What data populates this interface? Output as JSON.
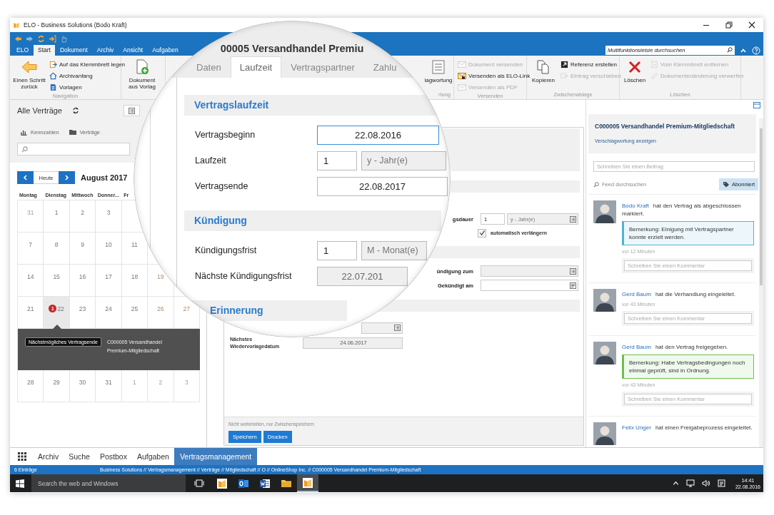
{
  "window": {
    "title": "ELO - Business Solutions (Bodo Kraft)"
  },
  "ribbon": {
    "tabs": [
      {
        "label": "ELO",
        "selected": false
      },
      {
        "label": "Start",
        "selected": true
      },
      {
        "label": "Dokument",
        "selected": false
      },
      {
        "label": "Archiv",
        "selected": false
      },
      {
        "label": "Ansicht",
        "selected": false
      },
      {
        "label": "Aufgaben",
        "selected": false
      }
    ],
    "search": {
      "placeholder": "Multifunktionsleiste durchsuchen"
    },
    "groups": [
      {
        "label": "Navigation",
        "items": [
          {
            "kind": "large",
            "label": "Einen Schritt zurück",
            "disabled": false
          },
          {
            "kind": "small",
            "label": "Auf das Klemmbrett legen",
            "disabled": false
          },
          {
            "kind": "small",
            "label": "Archivanfang",
            "disabled": false
          },
          {
            "kind": "small",
            "label": "Vorlagen",
            "disabled": false
          }
        ]
      },
      {
        "items": [
          {
            "kind": "large",
            "label": "Dokument aus Vorlag",
            "disabled": false
          }
        ]
      },
      {
        "label": "rtung",
        "items": [
          {
            "kind": "large",
            "label": "lagwortung",
            "disabled": false
          }
        ]
      },
      {
        "label": "Versenden",
        "items": [
          {
            "kind": "small",
            "label": "Dokument versenden",
            "disabled": true
          },
          {
            "kind": "small",
            "label": "Versenden als ELO-Link",
            "disabled": false
          },
          {
            "kind": "small",
            "label": "Versenden als PDF",
            "disabled": true
          }
        ]
      },
      {
        "label": "Zwischenablage",
        "items": [
          {
            "kind": "large",
            "label": "Kopieren",
            "disabled": false
          },
          {
            "kind": "small",
            "label": "Referenz erstellen",
            "disabled": false
          },
          {
            "kind": "small",
            "label": "Eintrag verschieben",
            "disabled": true
          }
        ]
      },
      {
        "label": "Löschen",
        "items": [
          {
            "kind": "large",
            "label": "Löschen",
            "disabled": false
          },
          {
            "kind": "small",
            "label": "Vom Klemmbrett entfernen",
            "disabled": true
          },
          {
            "kind": "small",
            "label": "Dokumentenänderung verwerfen",
            "disabled": true
          }
        ]
      }
    ]
  },
  "left_panel": {
    "title": "Alle Verträge",
    "toolbar": [
      "Kennzahlen",
      "Verträge"
    ]
  },
  "calendar": {
    "today_button": "Heute",
    "month": "August 2017",
    "weekdays": [
      "Montag",
      "Dienstag",
      "Mittwoch",
      "Donner...",
      "Fr"
    ],
    "weeks": [
      [
        {
          "day": "31",
          "muted": true,
          "selected": false
        },
        {
          "day": "1",
          "muted": false,
          "selected": false
        },
        {
          "day": "2",
          "muted": false,
          "selected": false
        },
        {
          "day": "3",
          "muted": false,
          "selected": false
        }
      ],
      [
        {
          "day": "7",
          "muted": false,
          "selected": false
        },
        {
          "day": "8",
          "muted": false,
          "selected": false
        },
        {
          "day": "9",
          "muted": false,
          "selected": false
        },
        {
          "day": "10",
          "muted": false,
          "selected": false
        },
        {
          "day": "11",
          "muted": false,
          "selected": false
        }
      ],
      [
        {
          "day": "14",
          "muted": false,
          "selected": false
        },
        {
          "day": "15",
          "muted": false,
          "selected": false
        },
        {
          "day": "16",
          "muted": false,
          "selected": false
        },
        {
          "day": "17",
          "muted": false,
          "selected": false
        },
        {
          "day": "18",
          "muted": false,
          "selected": false
        },
        {
          "day": "19",
          "muted": false,
          "selected": false
        }
      ],
      [
        {
          "day": "21",
          "muted": false,
          "selected": false
        },
        {
          "day": "22",
          "muted": false,
          "selected": true,
          "badge": "1"
        },
        {
          "day": "23",
          "muted": false,
          "selected": false
        },
        {
          "day": "24",
          "muted": false,
          "selected": false
        },
        {
          "day": "25",
          "muted": false,
          "selected": false
        },
        {
          "day": "26",
          "muted": false,
          "selected": false
        },
        {
          "day": "27",
          "muted": false,
          "selected": false
        }
      ],
      [
        {
          "day": "28",
          "muted": false,
          "selected": false
        },
        {
          "day": "29",
          "muted": false,
          "selected": false
        },
        {
          "day": "30",
          "muted": false,
          "selected": false
        },
        {
          "day": "31",
          "muted": false,
          "selected": false
        },
        {
          "day": "1",
          "muted": true,
          "selected": false
        },
        {
          "day": "2",
          "muted": true,
          "selected": false
        },
        {
          "day": "3",
          "muted": true,
          "selected": false
        }
      ]
    ],
    "popup": {
      "tag": "Nächstmögliches Vertragsende",
      "text": "C000005 Versandhandel Premium-Mitgliedschaft"
    }
  },
  "lens": {
    "title": "00005 Versandhandel Premiu",
    "tabs": [
      {
        "label": "Daten",
        "selected": false
      },
      {
        "label": "Laufzeit",
        "selected": true
      },
      {
        "label": "Vertragspartner",
        "selected": false
      },
      {
        "label": "Zahlu",
        "selected": false
      }
    ],
    "sections": [
      {
        "title": "Vertragslaufzeit",
        "rows": [
          {
            "kind": "date",
            "label": "Vertragsbeginn",
            "value": "22.08.2016",
            "focused": true,
            "disabled": false
          },
          {
            "kind": "period",
            "label": "Laufzeit",
            "value": "1",
            "unit": "y - Jahr(e)"
          },
          {
            "kind": "date",
            "label": "Vertragsende",
            "value": "22.08.2017",
            "focused": false,
            "disabled": false
          }
        ]
      },
      {
        "title": "Kündigung",
        "rows": [
          {
            "kind": "period",
            "label": "Kündigungsfrist",
            "value": "1",
            "unit": "M - Monat(e)"
          },
          {
            "kind": "date",
            "label": "Nächste Kündigungsfrist",
            "value": "22.07.201",
            "focused": false,
            "disabled": true
          }
        ]
      },
      {
        "title": "Erinnerung"
      }
    ]
  },
  "form": {
    "sections": [
      {
        "fields": [
          {
            "kind": "period",
            "label": "gsdauer",
            "value": "1",
            "unit": "y - Jahr(e)"
          },
          {
            "kind": "checkbox",
            "label": "automatisch verlängern",
            "checked": true
          }
        ]
      },
      {
        "fields": [
          {
            "kind": "date",
            "label": "ündigung zum",
            "disabled": true
          },
          {
            "kind": "date",
            "label": "Gekündigt am",
            "disabled": false
          }
        ]
      },
      {
        "fields": [
          {
            "kind": "select"
          },
          {
            "kind": "date",
            "label": "Nächstes Wiedervorlagedatum",
            "value": "24.06.2017",
            "disabled": true
          }
        ]
      }
    ],
    "note": "Nicht weiterleiten, nur Zwischenspeichern",
    "buttons": [
      "Speichern",
      "Drucken"
    ]
  },
  "feed": {
    "title": "C000005 Versandhandel Premium-Mitgliedschaft",
    "link": "Verschlagwortung anzeigen",
    "post": {
      "placeholder": "Schreiben Sie einen Beitrag"
    },
    "search": {
      "placeholder": "Feed durchsuchen"
    },
    "subscribe": "Abonniert",
    "entries": [
      {
        "author": "Bodo Kraft",
        "action": "hat den Vertrag als abgeschlossen markiert.",
        "remark": "Bemerkung: Einigung mit Vertragspartner konnte erzielt werden.",
        "color": "#4fb3d9",
        "time": "vor 12 Minuten",
        "comment": {
          "placeholder": "Schreiben Sie einen Kommentar"
        }
      },
      {
        "author": "Gerd Baum",
        "action": "hat die Verhandlung eingeleitet.",
        "time": "vor 43 Minuten",
        "comment": {
          "placeholder": "Schreiben Sie einen Kommentar"
        }
      },
      {
        "author": "Gerd Baum",
        "action": "hat den Vertrag freigegeben.",
        "remark": "Bemerkung: Habe Vertragsbedingungen noch einmal geprüft, sind in Ordnung.",
        "color": "#6cc04a",
        "time": "vor 43 Minuten",
        "comment": {
          "placeholder": "Schreiben Sie einen Kommentar"
        }
      },
      {
        "author": "Felix Unger",
        "action": "hat einen Freigabeprozess eingeleitet."
      }
    ]
  },
  "bottom_tabs": [
    {
      "label": "Archiv",
      "selected": false
    },
    {
      "label": "Suche",
      "selected": false
    },
    {
      "label": "Postbox",
      "selected": false
    },
    {
      "label": "Aufgaben",
      "selected": false
    },
    {
      "label": "Vertragsmanagement",
      "selected": true
    }
  ],
  "status_bar": {
    "count": "6 Einträge",
    "path": "Business Solutions // Vertragsmanagement // Verträge // Mitgliedschaft // O // OnlineShop Inc. // C000005 Versandhandel Premium-Mitgliedschaft"
  },
  "taskbar": {
    "search": {
      "placeholder": "Search the web and Windows"
    },
    "apps": [
      {
        "selected": false
      },
      {
        "selected": false
      },
      {
        "selected": false
      },
      {
        "selected": false
      },
      {
        "selected": true
      }
    ],
    "time": "14:41",
    "date": "22.08.2016"
  }
}
